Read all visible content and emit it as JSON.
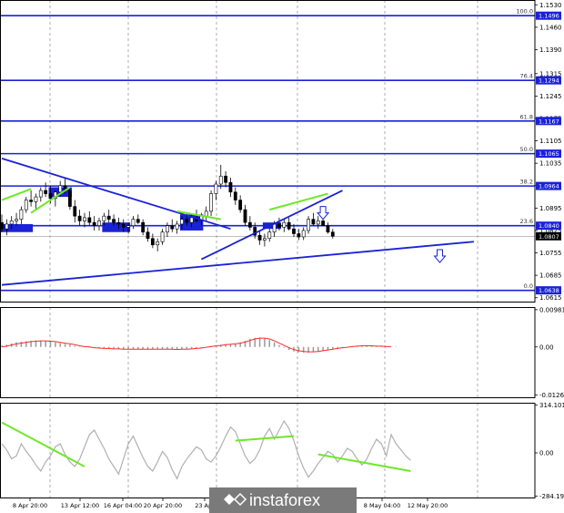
{
  "chart_data": [
    {
      "type": "candlestick",
      "pane": "price",
      "y_ticks": [
        "1.1530",
        "1.1460",
        "1.1390",
        "1.1315",
        "1.1245",
        "1.1175",
        "1.1105",
        "1.1035",
        "1.0965",
        "1.0895",
        "1.0825",
        "1.0755",
        "1.0685",
        "1.0615"
      ],
      "ylim": [
        1.06,
        1.1545
      ],
      "fib_levels": [
        {
          "pct": "100.0",
          "price": "1.1496",
          "value": 1.1496
        },
        {
          "pct": "76.4",
          "price": "1.1294",
          "value": 1.1294
        },
        {
          "pct": "61.8",
          "price": "1.1167",
          "value": 1.1167
        },
        {
          "pct": "50.0",
          "price": "1.1065",
          "value": 1.1065
        },
        {
          "pct": "38.2",
          "price": "1.0964",
          "value": 1.0964
        },
        {
          "pct": "23.6",
          "price": "1.0840",
          "value": 1.084
        },
        {
          "pct": "0.0",
          "price": "1.0638",
          "value": 1.0638
        }
      ],
      "current_price": {
        "label": "1.0807",
        "value": 1.0807
      },
      "candles": [
        {
          "o": 1.085,
          "h": 1.0875,
          "l": 1.082,
          "c": 1.083
        },
        {
          "o": 1.083,
          "h": 1.086,
          "l": 1.081,
          "c": 1.0845
        },
        {
          "o": 1.0845,
          "h": 1.087,
          "l": 1.083,
          "c": 1.0855
        },
        {
          "o": 1.0855,
          "h": 1.088,
          "l": 1.084,
          "c": 1.086
        },
        {
          "o": 1.086,
          "h": 1.09,
          "l": 1.0845,
          "c": 1.089
        },
        {
          "o": 1.089,
          "h": 1.093,
          "l": 1.088,
          "c": 1.092
        },
        {
          "o": 1.092,
          "h": 1.095,
          "l": 1.09,
          "c": 1.0915
        },
        {
          "o": 1.0915,
          "h": 1.094,
          "l": 1.089,
          "c": 1.093
        },
        {
          "o": 1.093,
          "h": 1.096,
          "l": 1.0915,
          "c": 1.095
        },
        {
          "o": 1.095,
          "h": 1.0975,
          "l": 1.093,
          "c": 1.094
        },
        {
          "o": 1.094,
          "h": 1.0965,
          "l": 1.091,
          "c": 1.0925
        },
        {
          "o": 1.0925,
          "h": 1.095,
          "l": 1.09,
          "c": 1.0945
        },
        {
          "o": 1.0945,
          "h": 1.098,
          "l": 1.093,
          "c": 1.0965
        },
        {
          "o": 1.0965,
          "h": 1.099,
          "l": 1.094,
          "c": 1.095
        },
        {
          "o": 1.095,
          "h": 1.096,
          "l": 1.089,
          "c": 1.09
        },
        {
          "o": 1.09,
          "h": 1.092,
          "l": 1.085,
          "c": 1.087
        },
        {
          "o": 1.087,
          "h": 1.089,
          "l": 1.084,
          "c": 1.0855
        },
        {
          "o": 1.0855,
          "h": 1.088,
          "l": 1.0835,
          "c": 1.0865
        },
        {
          "o": 1.0865,
          "h": 1.0885,
          "l": 1.084,
          "c": 1.085
        },
        {
          "o": 1.085,
          "h": 1.087,
          "l": 1.0825,
          "c": 1.084
        },
        {
          "o": 1.084,
          "h": 1.0865,
          "l": 1.0825,
          "c": 1.0855
        },
        {
          "o": 1.0855,
          "h": 1.088,
          "l": 1.084,
          "c": 1.087
        },
        {
          "o": 1.087,
          "h": 1.089,
          "l": 1.085,
          "c": 1.086
        },
        {
          "o": 1.086,
          "h": 1.0875,
          "l": 1.084,
          "c": 1.085
        },
        {
          "o": 1.085,
          "h": 1.0865,
          "l": 1.083,
          "c": 1.0845
        },
        {
          "o": 1.0845,
          "h": 1.086,
          "l": 1.082,
          "c": 1.0835
        },
        {
          "o": 1.0835,
          "h": 1.085,
          "l": 1.0815,
          "c": 1.084
        },
        {
          "o": 1.084,
          "h": 1.087,
          "l": 1.083,
          "c": 1.086
        },
        {
          "o": 1.086,
          "h": 1.0875,
          "l": 1.0845,
          "c": 1.085
        },
        {
          "o": 1.085,
          "h": 1.086,
          "l": 1.081,
          "c": 1.082
        },
        {
          "o": 1.082,
          "h": 1.0835,
          "l": 1.079,
          "c": 1.08
        },
        {
          "o": 1.08,
          "h": 1.0815,
          "l": 1.077,
          "c": 1.078
        },
        {
          "o": 1.078,
          "h": 1.08,
          "l": 1.076,
          "c": 1.079
        },
        {
          "o": 1.079,
          "h": 1.083,
          "l": 1.078,
          "c": 1.082
        },
        {
          "o": 1.082,
          "h": 1.085,
          "l": 1.0805,
          "c": 1.084
        },
        {
          "o": 1.084,
          "h": 1.086,
          "l": 1.082,
          "c": 1.083
        },
        {
          "o": 1.083,
          "h": 1.0855,
          "l": 1.0815,
          "c": 1.0845
        },
        {
          "o": 1.0845,
          "h": 1.087,
          "l": 1.083,
          "c": 1.086
        },
        {
          "o": 1.086,
          "h": 1.088,
          "l": 1.084,
          "c": 1.085
        },
        {
          "o": 1.085,
          "h": 1.0875,
          "l": 1.0835,
          "c": 1.0865
        },
        {
          "o": 1.0865,
          "h": 1.089,
          "l": 1.085,
          "c": 1.0855
        },
        {
          "o": 1.0855,
          "h": 1.088,
          "l": 1.084,
          "c": 1.087
        },
        {
          "o": 1.087,
          "h": 1.09,
          "l": 1.0855,
          "c": 1.0885
        },
        {
          "o": 1.0885,
          "h": 1.095,
          "l": 1.087,
          "c": 1.094
        },
        {
          "o": 1.094,
          "h": 1.098,
          "l": 1.092,
          "c": 1.097
        },
        {
          "o": 1.097,
          "h": 1.103,
          "l": 1.0955,
          "c": 1.0995
        },
        {
          "o": 1.0995,
          "h": 1.101,
          "l": 1.096,
          "c": 1.0975
        },
        {
          "o": 1.0975,
          "h": 1.099,
          "l": 1.093,
          "c": 1.0945
        },
        {
          "o": 1.0945,
          "h": 1.096,
          "l": 1.0905,
          "c": 1.092
        },
        {
          "o": 1.092,
          "h": 1.0935,
          "l": 1.088,
          "c": 1.089
        },
        {
          "o": 1.089,
          "h": 1.0905,
          "l": 1.084,
          "c": 1.085
        },
        {
          "o": 1.085,
          "h": 1.087,
          "l": 1.0825,
          "c": 1.0835
        },
        {
          "o": 1.0835,
          "h": 1.085,
          "l": 1.08,
          "c": 1.081
        },
        {
          "o": 1.081,
          "h": 1.0825,
          "l": 1.078,
          "c": 1.0795
        },
        {
          "o": 1.0795,
          "h": 1.0815,
          "l": 1.0775,
          "c": 1.08
        },
        {
          "o": 1.08,
          "h": 1.083,
          "l": 1.079,
          "c": 1.082
        },
        {
          "o": 1.082,
          "h": 1.0855,
          "l": 1.0805,
          "c": 1.0845
        },
        {
          "o": 1.0845,
          "h": 1.0865,
          "l": 1.0825,
          "c": 1.0835
        },
        {
          "o": 1.0835,
          "h": 1.086,
          "l": 1.082,
          "c": 1.085
        },
        {
          "o": 1.085,
          "h": 1.0865,
          "l": 1.0825,
          "c": 1.083
        },
        {
          "o": 1.083,
          "h": 1.0845,
          "l": 1.0805,
          "c": 1.0815
        },
        {
          "o": 1.0815,
          "h": 1.083,
          "l": 1.0795,
          "c": 1.0805
        },
        {
          "o": 1.0805,
          "h": 1.0835,
          "l": 1.0795,
          "c": 1.0825
        },
        {
          "o": 1.0825,
          "h": 1.087,
          "l": 1.0815,
          "c": 1.086
        },
        {
          "o": 1.086,
          "h": 1.088,
          "l": 1.084,
          "c": 1.0845
        },
        {
          "o": 1.0845,
          "h": 1.087,
          "l": 1.083,
          "c": 1.0855
        },
        {
          "o": 1.0855,
          "h": 1.09,
          "l": 1.084,
          "c": 1.084
        },
        {
          "o": 1.084,
          "h": 1.085,
          "l": 1.0815,
          "c": 1.082
        },
        {
          "o": 1.082,
          "h": 1.083,
          "l": 1.08,
          "c": 1.0807
        }
      ],
      "series": [
        {
          "kind": "trendline",
          "color": "#1a22d8",
          "points": [
            [
              0,
              1.105
            ],
            [
              47,
              1.083
            ]
          ]
        },
        {
          "kind": "trendline",
          "color": "#1a22d8",
          "points": [
            [
              0,
              1.0655
            ],
            [
              97,
              1.079
            ]
          ]
        },
        {
          "kind": "trendline",
          "color": "#1a22d8",
          "points": [
            [
              41,
              1.0735
            ],
            [
              70,
              1.095
            ]
          ]
        },
        {
          "kind": "divergence",
          "color": "#6ee82a",
          "points": [
            [
              0,
              1.092
            ],
            [
              6,
              1.0955
            ]
          ]
        },
        {
          "kind": "divergence",
          "color": "#6ee82a",
          "points": [
            [
              6,
              1.088
            ],
            [
              14,
              1.096
            ]
          ]
        },
        {
          "kind": "divergence",
          "color": "#6ee82a",
          "points": [
            [
              36,
              1.0885
            ],
            [
              45,
              1.086
            ]
          ]
        },
        {
          "kind": "divergence",
          "color": "#6ee82a",
          "points": [
            [
              55,
              1.089
            ],
            [
              67,
              1.094
            ]
          ]
        }
      ],
      "zones": [
        {
          "from": 0,
          "to": 6,
          "low": 1.082,
          "high": 1.0845,
          "color": "#1a22d8"
        },
        {
          "from": 10,
          "to": 14,
          "low": 1.093,
          "high": 1.096,
          "color": "#1a22d8"
        },
        {
          "from": 21,
          "to": 26,
          "low": 1.082,
          "high": 1.085,
          "color": "#1a22d8"
        },
        {
          "from": 37,
          "to": 41,
          "low": 1.0825,
          "high": 1.0875,
          "color": "#1a22d8"
        },
        {
          "from": 54,
          "to": 57,
          "low": 1.083,
          "high": 1.085,
          "color": "#1a22d8"
        }
      ],
      "arrows": [
        {
          "index": 66,
          "value": 1.088
        },
        {
          "index": 90,
          "value": 1.0745
        }
      ]
    },
    {
      "type": "histogram",
      "pane": "macd",
      "y_ticks": [
        "0.00981",
        "0.00",
        "-0.01263"
      ],
      "ylim": [
        -0.0135,
        0.0105
      ],
      "values": [
        0.0004,
        0.0006,
        0.0009,
        0.0012,
        0.0014,
        0.0015,
        0.0016,
        0.0017,
        0.0017,
        0.0016,
        0.0014,
        0.0012,
        0.001,
        0.0008,
        0.0006,
        0.0003,
        0.0001,
        -0.0001,
        -0.0002,
        -0.0003,
        -0.0004,
        -0.0004,
        -0.0005,
        -0.0005,
        -0.0006,
        -0.0006,
        -0.0006,
        -0.0006,
        -0.0006,
        -0.0006,
        -0.0006,
        -0.0006,
        -0.0006,
        -0.0006,
        -0.0006,
        -0.0007,
        -0.0007,
        -0.0006,
        -0.0005,
        -0.0004,
        -0.0003,
        -0.0002,
        0.0,
        0.0002,
        0.0004,
        0.0006,
        0.0007,
        0.0008,
        0.0009,
        0.0012,
        0.0016,
        0.0021,
        0.0024,
        0.0025,
        0.0022,
        0.0018,
        0.0012,
        0.0005,
        -0.0002,
        -0.0008,
        -0.0012,
        -0.0014,
        -0.0015,
        -0.0015,
        -0.0014,
        -0.0012,
        -0.001,
        -0.0008,
        -0.0006,
        -0.0004,
        -0.0002,
        0.0,
        0.0002,
        0.0003,
        0.0004,
        0.0004,
        0.0003,
        0.0003,
        0.0002,
        0.0002,
        0.0001,
        0.0001
      ],
      "signal": [
        0.0,
        0.0002,
        0.0005,
        0.0008,
        0.001,
        0.0012,
        0.0014,
        0.0015,
        0.0016,
        0.0016,
        0.0015,
        0.0014,
        0.0012,
        0.001,
        0.0008,
        0.0006,
        0.0003,
        0.0001,
        0.0,
        -0.0002,
        -0.0003,
        -0.0004,
        -0.0004,
        -0.0005,
        -0.0005,
        -0.0006,
        -0.0006,
        -0.0006,
        -0.0006,
        -0.0006,
        -0.0006,
        -0.0006,
        -0.0006,
        -0.0006,
        -0.0006,
        -0.0006,
        -0.0007,
        -0.0006,
        -0.0006,
        -0.0005,
        -0.0004,
        -0.0003,
        -0.0001,
        0.0001,
        0.0003,
        0.0004,
        0.0006,
        0.0007,
        0.0008,
        0.001,
        0.0013,
        0.0017,
        0.0021,
        0.0023,
        0.0023,
        0.0021,
        0.0016,
        0.001,
        0.0004,
        -0.0002,
        -0.0007,
        -0.001,
        -0.0012,
        -0.0013,
        -0.0013,
        -0.0012,
        -0.001,
        -0.0008,
        -0.0006,
        -0.0004,
        -0.0002,
        -0.0001,
        0.0001,
        0.0002,
        0.0003,
        0.0003,
        0.0003,
        0.0002,
        0.0002,
        0.0001,
        0.0001
      ]
    },
    {
      "type": "line",
      "pane": "cci",
      "y_ticks": [
        "314.1014",
        "0.00",
        "-284.1969"
      ],
      "ylim": [
        -300,
        330
      ],
      "values": [
        60,
        20,
        -40,
        -20,
        60,
        10,
        -30,
        -80,
        -120,
        -60,
        -20,
        40,
        60,
        -10,
        -60,
        -90,
        -40,
        40,
        120,
        150,
        90,
        30,
        -40,
        -90,
        -140,
        -40,
        60,
        110,
        40,
        -30,
        -90,
        -120,
        -60,
        10,
        -30,
        -110,
        -170,
        -90,
        -40,
        0,
        40,
        20,
        -40,
        -60,
        -20,
        40,
        110,
        170,
        140,
        60,
        -20,
        -70,
        -40,
        20,
        110,
        160,
        90,
        150,
        210,
        160,
        80,
        -20,
        -100,
        -160,
        -120,
        -70,
        -30,
        10,
        -10,
        -60,
        -20,
        30,
        10,
        -40,
        -80,
        -40,
        30,
        90,
        60,
        -20,
        120,
        60,
        20,
        -20,
        -50
      ],
      "series": [
        {
          "kind": "divergence",
          "color": "#6ee82a",
          "points": [
            [
              0,
              200
            ],
            [
              17,
              -90
            ]
          ]
        },
        {
          "kind": "divergence",
          "color": "#6ee82a",
          "points": [
            [
              48,
              80
            ],
            [
              60,
              110
            ]
          ]
        },
        {
          "kind": "divergence",
          "color": "#6ee82a",
          "points": [
            [
              65,
              -10
            ],
            [
              84,
              -120
            ]
          ]
        }
      ]
    }
  ],
  "x_ticks": [
    "8 Apr 20:00",
    "13 Apr 12:00",
    "16 Apr 04:00",
    "20 Apr 20:00",
    "23 Apr",
    "8 May 04:00",
    "12 May 20:00"
  ],
  "watermark": "instaforex",
  "colors": {
    "level": "#1a22d8",
    "accent": "#6ee82a",
    "ma": "#ff2b2b",
    "hist": "#9a9a9a",
    "osc": "#b0b0b0"
  }
}
